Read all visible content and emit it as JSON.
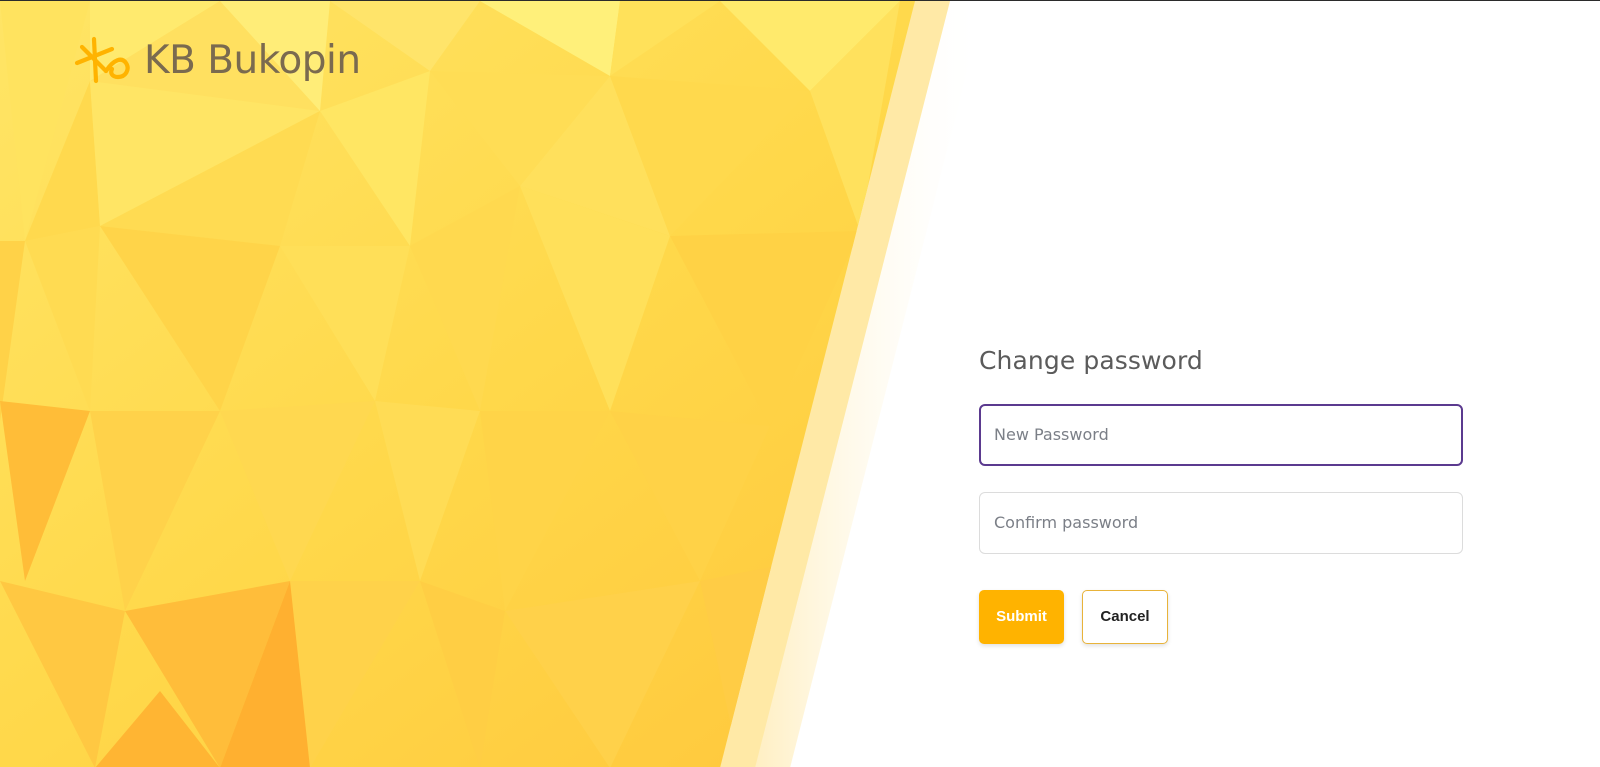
{
  "brand": {
    "name": "KB Bukopin",
    "logo_icon": "kb-swirl-logo-icon",
    "accent_color": "#ffb300",
    "text_color": "#7a6a4f"
  },
  "form": {
    "title": "Change password",
    "new_password": {
      "placeholder": "New Password",
      "value": ""
    },
    "confirm_password": {
      "placeholder": "Confirm password",
      "value": ""
    },
    "submit_label": "Submit",
    "cancel_label": "Cancel"
  },
  "colors": {
    "focus_border": "#5b3a8f",
    "submit_bg": "#ffb300",
    "cancel_border": "#e8b33a",
    "background_yellow": "#ffd84d"
  }
}
